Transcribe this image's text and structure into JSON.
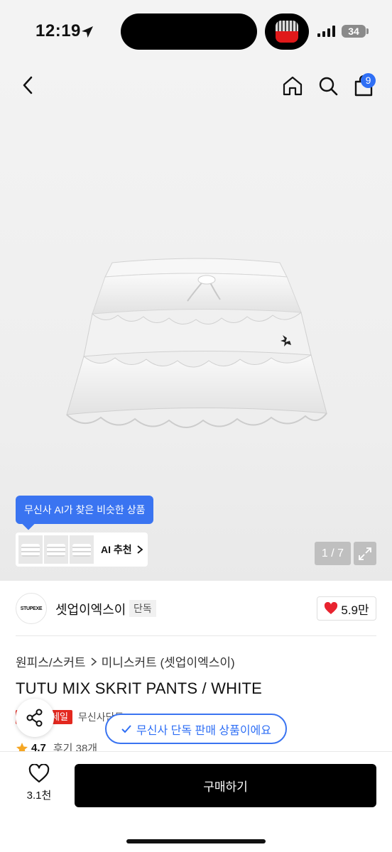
{
  "status": {
    "time": "12:19",
    "battery": "34"
  },
  "header": {
    "cart_count": "9"
  },
  "gallery": {
    "ai_tooltip": "무신사 AI가 찾은 비슷한 상품",
    "ai_recommend": "AI 추천",
    "counter": "1 / 7"
  },
  "brand": {
    "logo_text": "STUPEXE",
    "name": "셋업이엑스이",
    "tag": "단독",
    "likes": "5.9만"
  },
  "breadcrumb": {
    "category": "원피스/스커트",
    "subcategory": "미니스커트 (셋업이엑스이)"
  },
  "product": {
    "title": "TUTU MIX SKRIT PANTS / WHITE",
    "sale_tag": "세일",
    "exclusive_text": "무신사단독",
    "exclusive_pill": "무신사 단독 판매 상품이에요",
    "rating": "4.7",
    "reviews": "후기 38개"
  },
  "bottom": {
    "wish_count": "3.1천",
    "buy_label": "구매하기"
  },
  "colors": {
    "accent": "#2f6ff5",
    "sale": "#e3281f",
    "heart": "#e8232f"
  }
}
